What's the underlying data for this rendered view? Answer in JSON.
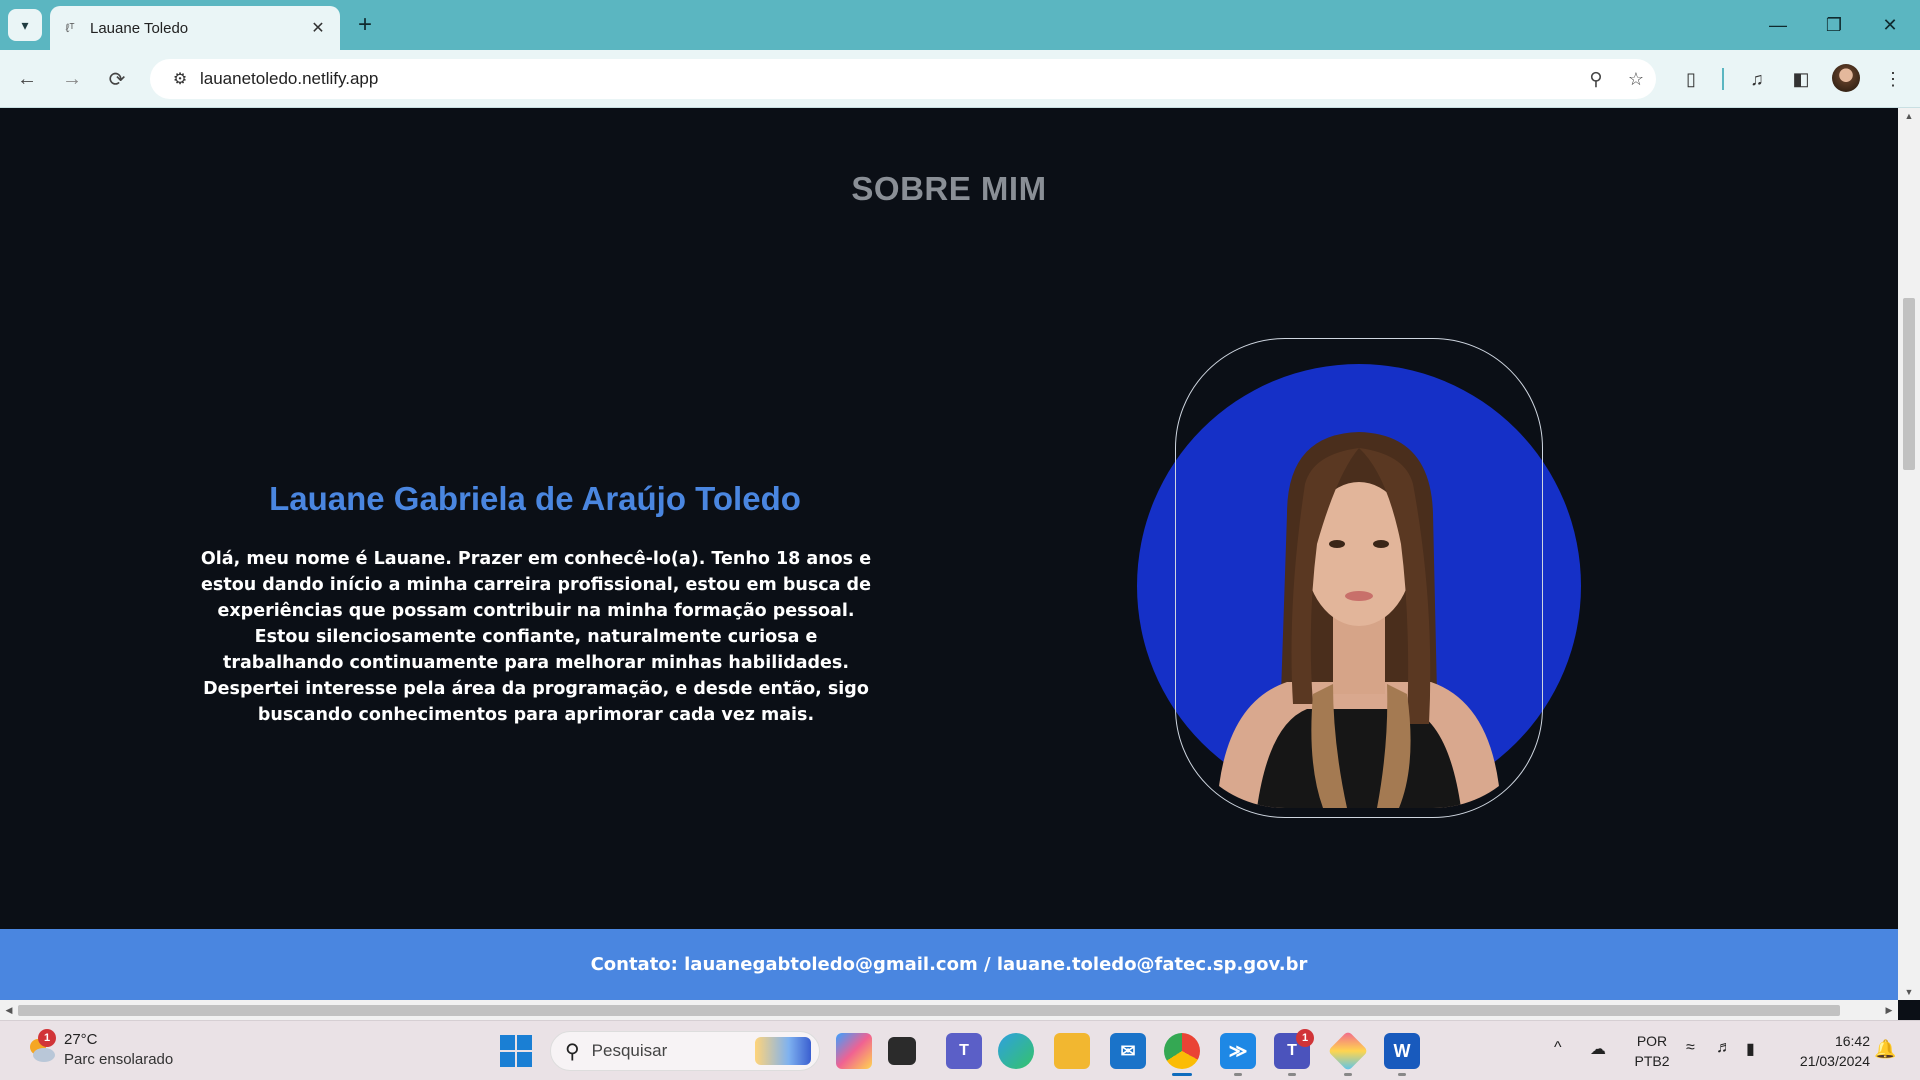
{
  "browser": {
    "tab_title": "Lauane Toledo",
    "url": "lauanetoledo.netlify.app",
    "icons": [
      "tab-search-icon",
      "favicon",
      "close-icon",
      "plus-icon",
      "minimize-icon",
      "restore-icon",
      "close-window-icon",
      "back-icon",
      "forward-icon",
      "reload-icon",
      "site-info-icon",
      "zoom-icon",
      "star-icon",
      "extensions-icon",
      "media-icon",
      "sidepanel-icon",
      "profile-avatar",
      "menu-icon"
    ]
  },
  "page": {
    "section_title": "SOBRE MIM",
    "name": "Lauane Gabriela de Araújo Toledo",
    "bio": "Olá, meu nome é Lauane. Prazer em conhecê-lo(a). Tenho 18 anos e estou dando início a minha carreira profissional, estou em busca de experiências que possam contribuir na minha formação pessoal. Estou silenciosamente confiante, naturalmente curiosa e trabalhando continuamente para melhorar minhas habilidades. Despertei interesse pela área da programação, e desde então, sigo buscando conhecimentos para aprimorar cada vez mais.",
    "footer_contact": "Contato: lauanegabtoledo@gmail.com / lauane.toledo@fatec.sp.gov.br",
    "colors": {
      "background": "#0b0f16",
      "accent": "#4a86e0",
      "photo_circle": "#1530c7",
      "title_gray": "#8a8f96"
    }
  },
  "taskbar": {
    "weather_temp": "27°C",
    "weather_desc": "Parc ensolarado",
    "weather_badge": "1",
    "search_placeholder": "Pesquisar",
    "teams_badge": "1",
    "lang_line1": "POR",
    "lang_line2": "PTB2",
    "time": "16:42",
    "date": "21/03/2024"
  }
}
